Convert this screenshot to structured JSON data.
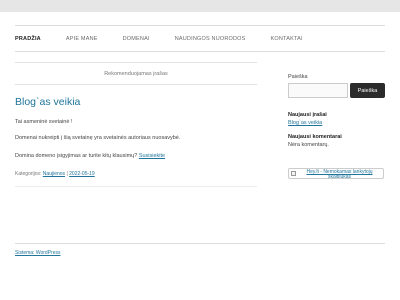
{
  "nav": {
    "items": [
      {
        "label": "PRADŽIA",
        "active": true
      },
      {
        "label": "APIE MANE"
      },
      {
        "label": "DOMENAI"
      },
      {
        "label": "NAUDINGOS NUORODOS"
      },
      {
        "label": "KONTAKTAI"
      }
    ]
  },
  "main": {
    "featured_label": "Rekomenduojamas įrašas",
    "post": {
      "title": "Blog`as veikia",
      "paragraphs": {
        "p1": "Tai asmeninė svetainė !",
        "p2": "Domenai nukreipti į šią svetainę yra svetainės autoriaus nuosavybė.",
        "p3": "Domina domeno įsigyjimas ar turite kitų klausimų?",
        "p3_link": "Susisiekite"
      },
      "meta": {
        "category_prefix": "Kategorijos:",
        "category": "Naujienos",
        "separator": "|",
        "date": "2022-05-19"
      }
    }
  },
  "sidebar": {
    "search": {
      "label": "Paieška",
      "placeholder": "",
      "button": "Paieška"
    },
    "recent_posts": {
      "title": "Naujausi įrašai",
      "item": "Blog`as veikia"
    },
    "recent_comments": {
      "title": "Naujausi komentarai",
      "text": "Nėra komentarų."
    },
    "banner": {
      "alt_text": "Hey.lt - Nemokamas lankytojų skaitliukas",
      "icon": "broken-image-icon"
    }
  },
  "footer": {
    "text": "Sistema: WordPress"
  }
}
